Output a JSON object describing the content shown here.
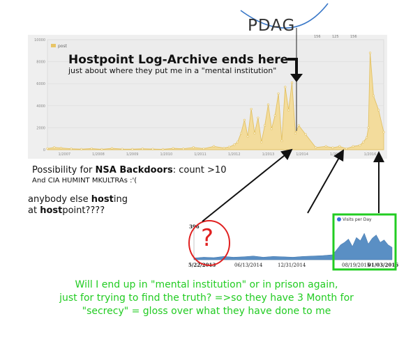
{
  "logo": {
    "text": "PDAG"
  },
  "main_chart": {
    "legend": "post",
    "y_ticks": [
      "10000",
      "8000",
      "6000",
      "4000",
      "2000",
      "0"
    ],
    "x_ticks": [
      "1/2007",
      "1/2008",
      "1/2009",
      "1/2010",
      "1/2011",
      "1/2012",
      "1/2013",
      "1/2014",
      "1/2015",
      "1/2016"
    ],
    "top_right_labels": [
      "156",
      "125",
      "156"
    ]
  },
  "annotations": {
    "hostpoint_title": "Hostpoint Log-Archive ends here",
    "hostpoint_sub": "just about where they put me in a \"mental institution\"",
    "nsa_prefix": "Possibility for ",
    "nsa_bold": "NSA Backdoors",
    "nsa_suffix": ": count >10",
    "cia": "And CIA HUMINT MKULTRAs :'(",
    "anybody_1": "anybody else ",
    "anybody_bold": "host",
    "anybody_2": "ing",
    "at_1": "at ",
    "at_bold": "host",
    "at_2": "point????",
    "question": "?"
  },
  "visits_chart": {
    "legend": "Visits per Day",
    "y_max_label": "396",
    "x_labels": [
      "5/22/2013",
      "06/13/2014",
      "12/31/2014",
      "08/19/2015",
      "01/03/2016"
    ]
  },
  "closing_text": [
    "Will I end up in \"mental  institution\" or in prison again,",
    "just for trying to find the truth? =>so they have 3 Month for",
    "\"secrecy\" = gloss over what they have done to me"
  ],
  "colors": {
    "area_fill": "#f3dc9c",
    "area_line": "#e2c164",
    "visits_fill": "#5a8fc4",
    "green": "#22cc22",
    "red": "#e02020",
    "panel_bg": "#efefef"
  },
  "chart_data": [
    {
      "type": "area",
      "series": [
        {
          "name": "post",
          "x": [
            2006.6,
            2006.8,
            2007.0,
            2007.3,
            2007.6,
            2007.9,
            2008.2,
            2008.5,
            2008.8,
            2009.1,
            2009.4,
            2009.7,
            2010.0,
            2010.3,
            2010.6,
            2010.9,
            2011.2,
            2011.5,
            2011.8,
            2011.95,
            2012.1,
            2012.2,
            2012.3,
            2012.4,
            2012.5,
            2012.6,
            2012.7,
            2012.8,
            2012.9,
            2013.0,
            2013.1,
            2013.2,
            2013.3,
            2013.4,
            2013.5,
            2013.6,
            2013.7,
            2013.8,
            2013.9,
            2014.0,
            2014.2,
            2014.5,
            2014.8,
            2015.0,
            2015.2,
            2015.4,
            2015.6,
            2015.8,
            2015.9,
            2016.0,
            2016.05,
            2016.1,
            2016.2,
            2016.35,
            2016.5
          ],
          "values": [
            100,
            200,
            150,
            80,
            50,
            100,
            40,
            120,
            60,
            50,
            80,
            60,
            40,
            120,
            80,
            200,
            100,
            300,
            150,
            250,
            450,
            700,
            1500,
            2700,
            1200,
            3700,
            1500,
            2900,
            700,
            2200,
            4100,
            1900,
            3100,
            5100,
            800,
            5700,
            3600,
            6100,
            1500,
            2200,
            1400,
            200,
            300,
            180,
            300,
            100,
            300,
            400,
            700,
            1100,
            2000,
            8800,
            4900,
            3600,
            1600
          ]
        }
      ],
      "xlim": [
        2006.6,
        2016.5
      ],
      "ylim": [
        0,
        10000
      ],
      "legend_position": "top-left"
    },
    {
      "type": "area",
      "series": [
        {
          "name": "Visits per Day",
          "x": [
            0,
            0.05,
            0.1,
            0.15,
            0.2,
            0.25,
            0.3,
            0.35,
            0.4,
            0.45,
            0.5,
            0.55,
            0.6,
            0.65,
            0.7,
            0.72,
            0.74,
            0.76,
            0.78,
            0.8,
            0.82,
            0.84,
            0.86,
            0.88,
            0.9,
            0.92,
            0.94,
            0.96,
            0.98,
            1.0
          ],
          "values": [
            20,
            30,
            25,
            40,
            30,
            35,
            45,
            30,
            40,
            35,
            30,
            40,
            45,
            50,
            60,
            120,
            180,
            210,
            250,
            160,
            270,
            230,
            320,
            190,
            260,
            300,
            210,
            240,
            180,
            150
          ]
        }
      ],
      "ylim": [
        0,
        396
      ],
      "legend_position": "top-left"
    }
  ]
}
